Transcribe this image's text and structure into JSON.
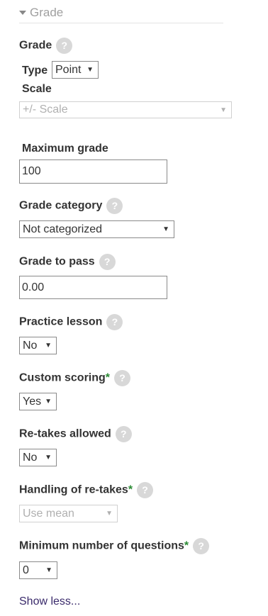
{
  "section": {
    "title": "Grade"
  },
  "grade": {
    "label": "Grade",
    "type_label": "Type",
    "type_value": "Point",
    "scale_label": "Scale",
    "scale_value": "+/- Scale"
  },
  "max_grade": {
    "label": "Maximum grade",
    "value": "100"
  },
  "grade_category": {
    "label": "Grade category",
    "value": "Not categorized"
  },
  "grade_to_pass": {
    "label": "Grade to pass",
    "value": "0.00"
  },
  "practice_lesson": {
    "label": "Practice lesson",
    "value": "No"
  },
  "custom_scoring": {
    "label": "Custom scoring",
    "required_mark": "*",
    "value": "Yes"
  },
  "retakes_allowed": {
    "label": "Re-takes allowed",
    "value": "No"
  },
  "handling_retakes": {
    "label": "Handling of re-takes",
    "required_mark": "*",
    "value": "Use mean"
  },
  "min_questions": {
    "label": "Minimum number of questions",
    "required_mark": "*",
    "value": "0"
  },
  "help_glyph": "?",
  "caret_glyph": "▼",
  "show_less": "Show less...",
  "colors": {
    "required": "#2a8a34",
    "link": "#3a2a6b",
    "help_bg": "#d8d8d8"
  }
}
